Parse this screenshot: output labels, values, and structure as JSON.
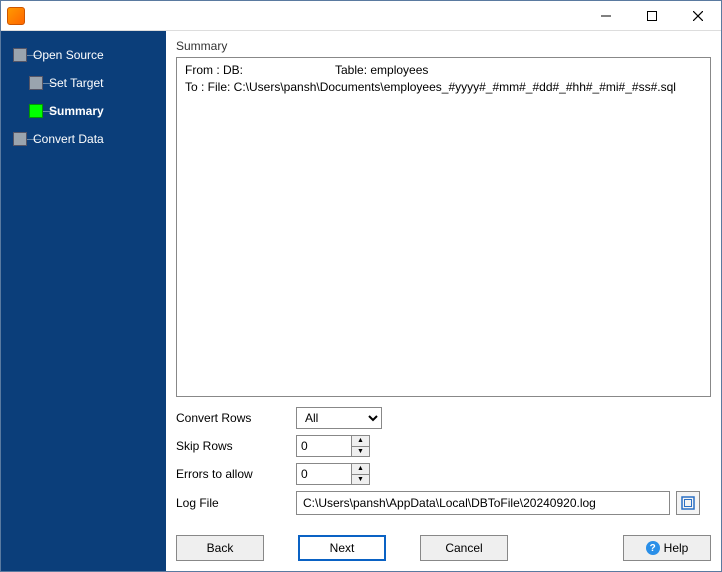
{
  "titlebar": {
    "title": ""
  },
  "nav": {
    "items": [
      {
        "label": "Open Source"
      },
      {
        "label": "Set Target"
      },
      {
        "label": "Summary"
      },
      {
        "label": "Convert Data"
      }
    ]
  },
  "summary": {
    "heading": "Summary",
    "from_prefix": "From : DB:",
    "table_label": "Table: employees",
    "to_line": "To : File: C:\\Users\\pansh\\Documents\\employees_#yyyy#_#mm#_#dd#_#hh#_#mi#_#ss#.sql"
  },
  "form": {
    "convert_rows_label": "Convert Rows",
    "convert_rows_value": "All",
    "skip_rows_label": "Skip Rows",
    "skip_rows_value": "0",
    "errors_label": "Errors to allow",
    "errors_value": "0",
    "logfile_label": "Log File",
    "logfile_value": "C:\\Users\\pansh\\AppData\\Local\\DBToFile\\20240920.log"
  },
  "buttons": {
    "back": "Back",
    "next": "Next",
    "cancel": "Cancel",
    "help": "Help"
  }
}
